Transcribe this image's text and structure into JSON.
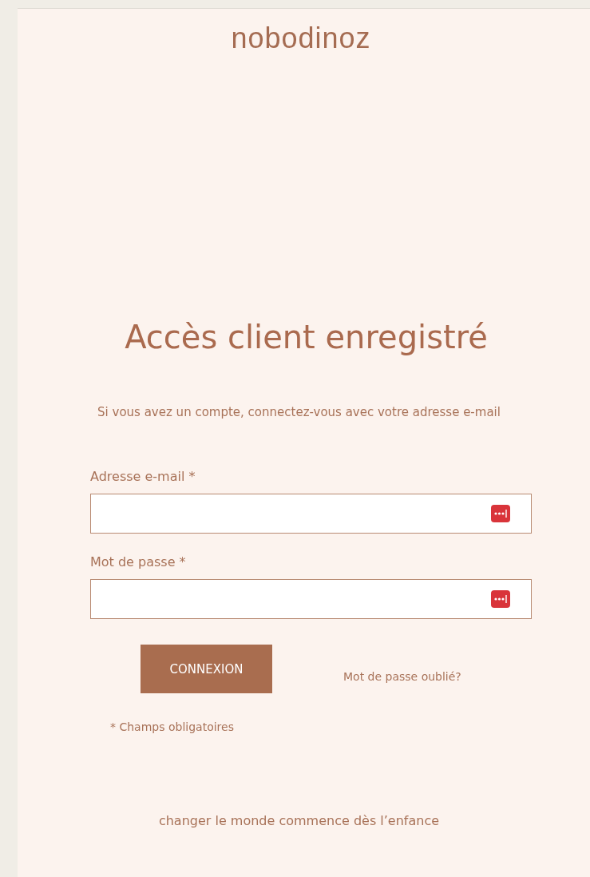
{
  "logo": "nobodinoz",
  "title": "Accès client enregistré",
  "intro": "Si vous avez un compte, connectez-vous avec votre adresse e-mail",
  "fields": [
    {
      "label": "Adresse e-mail *"
    },
    {
      "label": "Mot de passe *"
    }
  ],
  "submit_button": "CONNEXION",
  "forgot_link": "Mot de passe oublié?",
  "required_note": "* Champs obligatoires",
  "tagline": "changer le monde commence dès l’enfance"
}
